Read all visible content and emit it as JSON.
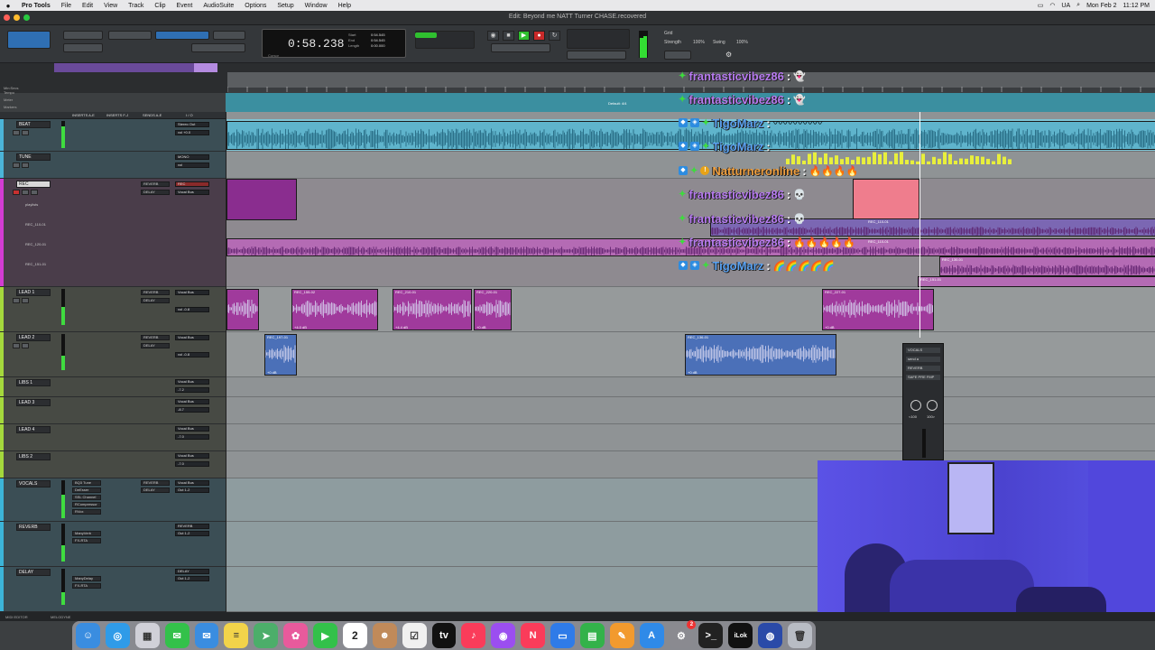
{
  "menubar": {
    "app_name": "Pro Tools",
    "items": [
      "File",
      "Edit",
      "View",
      "Track",
      "Clip",
      "Event",
      "AudioSuite",
      "Options",
      "Setup",
      "Window",
      "Help"
    ],
    "status_items": [
      "UA",
      "Mon Feb 2",
      "11:12 PM"
    ]
  },
  "window": {
    "title": "Edit: Beyond me NATT Turner CHASE.recovered"
  },
  "counter": {
    "main_time": "58.238",
    "minutes": "0:",
    "labels": [
      "Start",
      "End",
      "Length"
    ],
    "values": [
      "0:54.545",
      "0:54.545",
      "0:00.000"
    ],
    "cursor_label": "Cursor"
  },
  "grid": {
    "grid_label": "Grid",
    "nudge_label": "Nudge",
    "strength_label": "Strength",
    "swing_label": "Swing",
    "strength_value": "100%",
    "swing_value": "100%"
  },
  "ruler_labels": [
    "Min:Secs",
    "Tempo",
    "Meter",
    "Markers"
  ],
  "ruler_marker_text": "Default: 4/4",
  "column_headers": {
    "inserts_ae": "INSERTS A-E",
    "inserts_fj": "INSERTS F-J",
    "sends": "SENDS A-E",
    "io": "I / O"
  },
  "tracks": [
    {
      "name": "BEAT",
      "color": "#4bb4d8",
      "io1": "Stereo Out",
      "io2": "vol  +0.0"
    },
    {
      "name": "TUNE",
      "color": "#4bb4d8",
      "io1": "MONO",
      "io2": "vol"
    },
    {
      "name": "REC",
      "color": "#d23cd2",
      "sends": [
        "REVERB",
        "DELAY"
      ],
      "io1": "REC",
      "io2": "Vocal Bus",
      "subs": [
        "playlists",
        "REC_110-01",
        "REC_120-01",
        "REC_151-01"
      ]
    },
    {
      "name": "LEAD 1",
      "color": "#a4d83c",
      "sends": [
        "REVERB",
        "DELAY"
      ],
      "io1": "Vocal Bus",
      "io2": "vol  -0.8"
    },
    {
      "name": "LEAD 2",
      "color": "#a4d83c",
      "sends": [
        "REVERB",
        "DELAY"
      ],
      "io1": "Vocal Bus",
      "io2": "vol  -0.8"
    },
    {
      "name": "LIBS 1",
      "color": "#a4d83c",
      "io1": "Vocal Bus",
      "io2": "-7.2"
    },
    {
      "name": "LEAD 3",
      "color": "#a4d83c",
      "io1": "Vocal Bus",
      "io2": "-8.7"
    },
    {
      "name": "LEAD 4",
      "color": "#a4d83c",
      "io1": "Vocal Bus",
      "io2": "-7.0"
    },
    {
      "name": "LIBS 2",
      "color": "#a4d83c",
      "io1": "Vocal Bus",
      "io2": "-7.0"
    },
    {
      "name": "VOCALS",
      "color": "#3cb4d8",
      "inserts": [
        "BQ3 Tune",
        "DeEsser",
        "SSL Channel",
        "RCompressor",
        "RVox"
      ],
      "sends": [
        "REVERB",
        "DELAY"
      ],
      "io1": "Vocal Bus",
      "io2": "Out 1-2"
    },
    {
      "name": "REVERB",
      "color": "#3cb4d8",
      "inserts": [
        "ManyVerb",
        "FX-RTA"
      ],
      "sends": [
        "REVERB"
      ],
      "io1": "REVERB",
      "io2": "Out 1-2"
    },
    {
      "name": "DELAY",
      "color": "#3cb4d8",
      "inserts": [
        "ManyDelay",
        "FX-RTA"
      ],
      "sends": [
        "DELAY"
      ],
      "io1": "DELAY",
      "io2": "Out 1-2"
    }
  ],
  "clips": {
    "lead1": [
      {
        "name": "",
        "gain": ""
      },
      {
        "name": "REC_155-02",
        "gain": "+4.0 dB"
      },
      {
        "name": "REC_210-01",
        "gain": "+4.4 dB"
      },
      {
        "name": "REC_220-01",
        "gain": "+0 dB"
      },
      {
        "name": "REC_227-01",
        "gain": "+0 dB"
      }
    ],
    "lead2": [
      {
        "name": "REC_197-01",
        "gain": "+0 dB"
      },
      {
        "name": "REC_136-01",
        "gain": "+0 dB"
      }
    ],
    "rec": [
      {
        "name": "REC_110-01"
      },
      {
        "name": "REC_120-01"
      },
      {
        "name": "REC_151-01"
      },
      {
        "name": "REC_130-01"
      }
    ]
  },
  "chat": [
    {
      "user": "frantasticvibez86",
      "msg": "👻",
      "style": "purple",
      "icons": "diamond"
    },
    {
      "user": "frantasticvibez86",
      "msg": "👻",
      "style": "purple",
      "icons": "diamond"
    },
    {
      "user": "TigoMarz",
      "msg": "〰〰〰〰〰",
      "style": "blue",
      "icons": "both"
    },
    {
      "user": "TigoMarz",
      "msg": "",
      "style": "blue",
      "icons": "both"
    },
    {
      "user": "Natturneronline",
      "msg": "🔥🔥🔥🔥",
      "style": "orange",
      "icons": "badge"
    },
    {
      "user": "frantasticvibez86",
      "msg": "💀",
      "style": "purple",
      "icons": "diamond"
    },
    {
      "user": "frantasticvibez86",
      "msg": "💀",
      "style": "purple",
      "icons": "diamond"
    },
    {
      "user": "frantasticvibez86",
      "msg": "🔥🔥🔥🔥🔥",
      "style": "purple",
      "icons": "diamond"
    },
    {
      "user": "TigoMarz",
      "msg": "🌈🌈🌈🌈🌈",
      "style": "blue",
      "icons": "both"
    }
  ],
  "float_strip": {
    "name": "VOCALS",
    "items": [
      "send a",
      "REVERB",
      "SAFE  PRE  FMP"
    ],
    "pan_values": [
      "<100",
      "100>"
    ]
  },
  "bottom_bar": {
    "left1": "MIDI EDITOR",
    "left2": "MELODYNE"
  },
  "dock_apps": [
    "Finder",
    "Safari",
    "Launchpad",
    "Messages",
    "Mail",
    "Notes",
    "Maps",
    "Photos",
    "FaceTime",
    "Calendar",
    "Contacts",
    "Reminders",
    "TV",
    "Music",
    "Podcasts",
    "News",
    "Keynote",
    "Numbers",
    "Pages",
    "App Store",
    "System Settings",
    "Terminal",
    "iLok",
    "Pro Tools",
    "Trash"
  ],
  "dock_calendar_day": "2",
  "dock_badge": "2",
  "colors": {
    "accent_blue": "#2f6fb3",
    "record_red": "#c92a2a",
    "play_green": "#2fbf2f",
    "rec_clip": "#9b2f9b",
    "lead_clip": "#b03aa0",
    "beat_clip": "#4fa6c8",
    "chat_purple": "#b77bf0",
    "chat_blue": "#5aa2f2"
  }
}
